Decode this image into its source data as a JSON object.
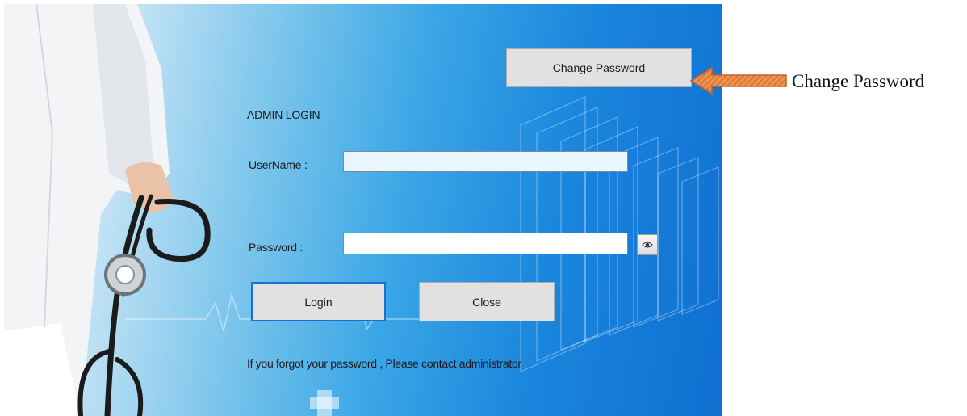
{
  "login": {
    "heading": "ADMIN LOGIN",
    "username_label": "UserName :",
    "username_value": "",
    "password_label": "Password :",
    "password_value": "",
    "show_password_icon": "eye-icon",
    "login_label": "Login",
    "close_label": "Close",
    "change_password_label": "Change Password",
    "forgot_text": "If you forgot your password , Please contact administrator"
  },
  "annotation": {
    "label": "Change Password",
    "arrow_color": "#e07b39"
  },
  "colors": {
    "accent": "#1b6fd2",
    "button_face": "#e1e1e1",
    "username_field_bg": "#e9f6fe"
  }
}
